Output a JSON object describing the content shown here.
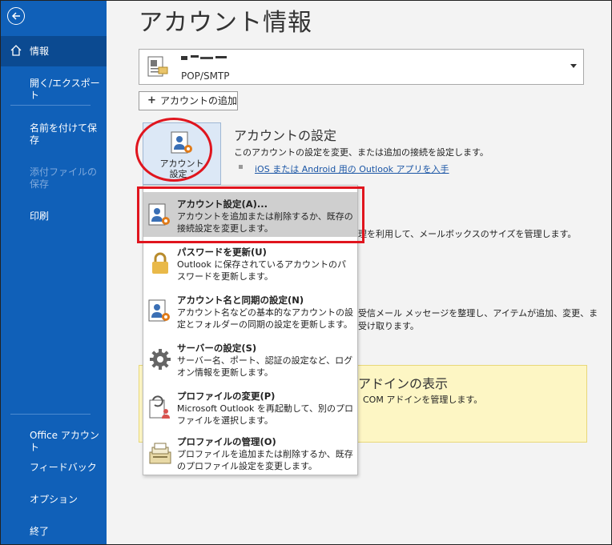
{
  "sidebar": {
    "items": [
      {
        "label": "情報"
      },
      {
        "label": "開く/エクスポート"
      },
      {
        "label": "名前を付けて保存"
      },
      {
        "label": "添付ファイルの保存"
      },
      {
        "label": "印刷"
      },
      {
        "label": "Office アカウント"
      },
      {
        "label": "フィードバック"
      },
      {
        "label": "オプション"
      },
      {
        "label": "終了"
      }
    ]
  },
  "main": {
    "title": "アカウント情報",
    "account_selector": {
      "type": "POP/SMTP"
    },
    "add_account_label": "アカウントの追加",
    "account_settings_button": {
      "line1": "アカウント",
      "line2": "設定 ˅"
    },
    "section": {
      "title": "アカウントの設定",
      "description": "このアカウントの設定を変更、または追加の接続を設定します。",
      "link": "iOS または Android 用の Outlook アプリを入手"
    },
    "bg_text_1": "理を利用して、メールボックスのサイズを管理します。",
    "bg_text_2a": "受信メール メッセージを整理し、アイテムが追加、変更、ま",
    "bg_text_2b": "受け取ります。",
    "addin": {
      "title": "アドインの表示",
      "description": "COM アドインを管理します。"
    }
  },
  "menu": [
    {
      "title": "アカウント設定(A)...",
      "desc": "アカウントを追加または削除するか、既存の接続設定を変更します。",
      "icon": "account-settings-icon"
    },
    {
      "title": "パスワードを更新(U)",
      "desc": "Outlook に保存されているアカウントのパスワードを更新します。",
      "icon": "lock-icon"
    },
    {
      "title": "アカウント名と同期の設定(N)",
      "desc": "アカウント名などの基本的なアカウントの設定とフォルダーの同期の設定を更新します。",
      "icon": "account-sync-icon"
    },
    {
      "title": "サーバーの設定(S)",
      "desc": "サーバー名、ポート、認証の設定など、ログオン情報を更新します。",
      "icon": "gear-icon"
    },
    {
      "title": "プロファイルの変更(P)",
      "desc": "Microsoft Outlook を再起動して、別のプロファイルを選択します。",
      "icon": "profile-change-icon"
    },
    {
      "title": "プロファイルの管理(O)",
      "desc": "プロファイルを追加または削除するか、既存のプロファイル設定を変更します。",
      "icon": "profile-manage-icon"
    }
  ],
  "colors": {
    "sidebar": "#1060b8",
    "highlight": "#e0151e",
    "addin_bg": "#fdf6c4"
  }
}
